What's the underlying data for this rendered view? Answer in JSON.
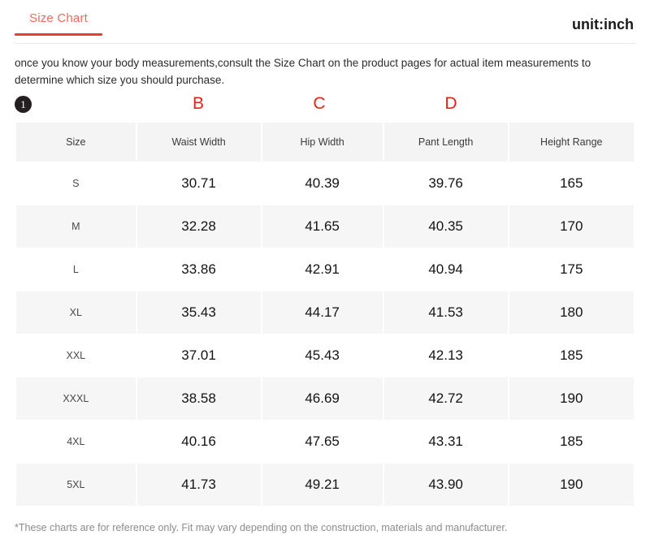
{
  "header": {
    "tab_label": "Size Chart",
    "unit_label": "unit:inch"
  },
  "intro": {
    "text": "once you know your body measurements,consult the Size Chart on the product pages for actual item measurements to determine which size you should purchase."
  },
  "callouts": {
    "badge": "1",
    "letter_b": "B",
    "letter_c": "C",
    "letter_d": "D"
  },
  "footnote": {
    "text": "*These charts are for reference only. Fit may vary depending on the construction, materials and manufacturer."
  },
  "chart_data": {
    "type": "table",
    "title": "Size Chart",
    "unit": "inch",
    "columns": [
      "Size",
      "Waist Width",
      "Hip Width",
      "Pant Length",
      "Height Range"
    ],
    "rows": [
      [
        "S",
        "30.71",
        "40.39",
        "39.76",
        "165"
      ],
      [
        "M",
        "32.28",
        "41.65",
        "40.35",
        "170"
      ],
      [
        "L",
        "33.86",
        "42.91",
        "40.94",
        "175"
      ],
      [
        "XL",
        "35.43",
        "44.17",
        "41.53",
        "180"
      ],
      [
        "XXL",
        "37.01",
        "45.43",
        "42.13",
        "185"
      ],
      [
        "XXXL",
        "38.58",
        "46.69",
        "42.72",
        "190"
      ],
      [
        "4XL",
        "40.16",
        "47.65",
        "43.31",
        "185"
      ],
      [
        "5XL",
        "41.73",
        "49.21",
        "43.90",
        "190"
      ]
    ]
  },
  "colors": {
    "accent": "#ef3b2d",
    "tab_text": "#f2695c",
    "callout_letter": "#e8231a",
    "row_stripe": "#f6f6f6",
    "header_bg": "#f4f4f4"
  }
}
